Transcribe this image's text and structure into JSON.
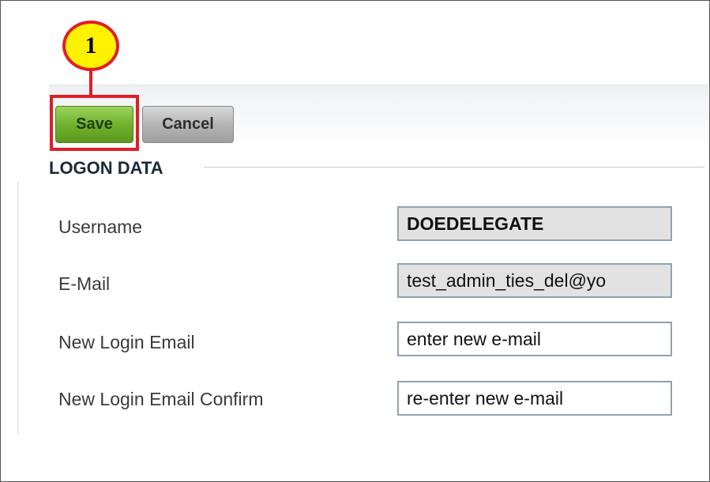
{
  "callout": {
    "number": "1"
  },
  "toolbar": {
    "save_label": "Save",
    "cancel_label": "Cancel"
  },
  "section": {
    "title": "LOGON DATA"
  },
  "form": {
    "username": {
      "label": "Username",
      "value": "DOEDELEGATE"
    },
    "email": {
      "label": "E-Mail",
      "value": "test_admin_ties_del@yo"
    },
    "new_login_email": {
      "label": "New Login Email",
      "placeholder": "enter new e-mail"
    },
    "new_login_email_confirm": {
      "label": "New Login Email Confirm",
      "placeholder": "re-enter new e-mail"
    }
  },
  "colors": {
    "highlight": "#e01e26",
    "callout_fill": "#fff200",
    "save_green": "#6fae2a",
    "cancel_grey": "#b3b3b3",
    "field_border": "#8ea2b4"
  }
}
